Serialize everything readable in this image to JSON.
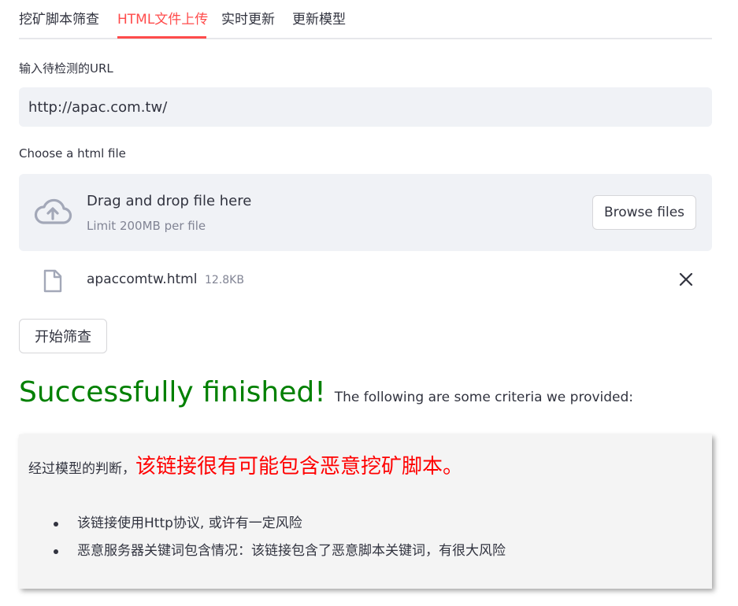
{
  "tabs": [
    {
      "label": "挖矿脚本筛查",
      "active": false
    },
    {
      "label": "HTML文件上传",
      "active": true
    },
    {
      "label": "实时更新",
      "active": false
    },
    {
      "label": "更新模型",
      "active": false
    }
  ],
  "url_input": {
    "label": "输入待检测的URL",
    "value": "http://apac.com.tw/"
  },
  "uploader": {
    "label": "Choose a html file",
    "drag_text": "Drag and drop file here",
    "limit_text": "Limit 200MB per file",
    "browse_label": "Browse files",
    "cloud_icon": "cloud-upload-icon"
  },
  "uploaded_file": {
    "name": "apaccomtw.html",
    "size": "12.8KB",
    "file_icon": "file-icon",
    "remove_icon": "close-icon"
  },
  "start_button": {
    "label": "开始筛查"
  },
  "result": {
    "title": "Successfully finished!",
    "subtitle": "The following are some criteria we provided:",
    "verdict_prefix": "经过模型的判断，",
    "verdict_main": "该链接很有可能包含恶意挖矿脚本。",
    "criteria": [
      "该链接使用Http协议, 或许有一定风险",
      "恶意服务器关键词包含情况：该链接包含了恶意脚本关键词，有很大风险"
    ]
  },
  "colors": {
    "accent": "#ff4b4b",
    "success": "#008000",
    "danger": "#ff0000",
    "input_bg": "#f0f2f6"
  }
}
